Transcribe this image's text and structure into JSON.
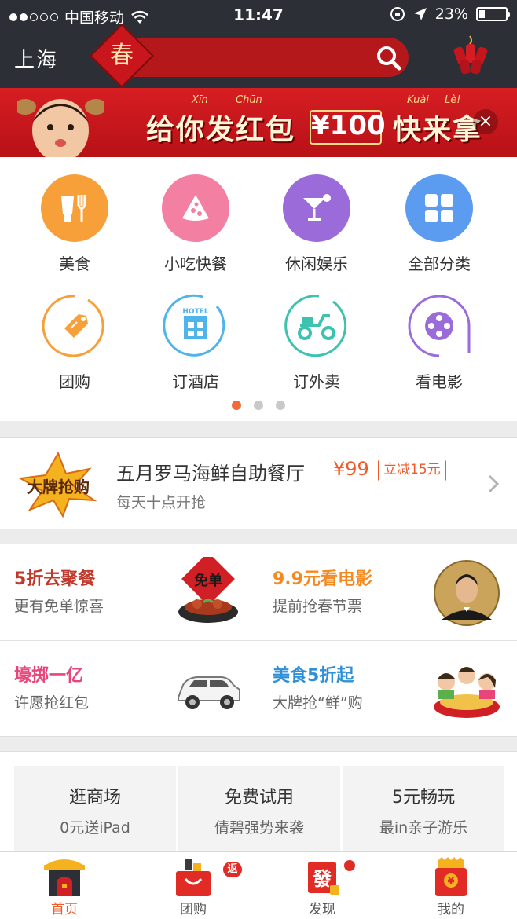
{
  "status_bar": {
    "carrier": "中国移动",
    "time": "11:47",
    "battery_percent": "23%",
    "battery_level": 0.23,
    "signal_filled": 2,
    "signal_total": 5
  },
  "header": {
    "city": "上海",
    "search_badge": "春",
    "search_icon": "search-icon",
    "right_icon": "firecracker-icon"
  },
  "banner": {
    "pinyin": [
      "Xīn",
      "Chūn",
      "Kuài",
      "Lè!"
    ],
    "text_left": "给你发红包",
    "money": "¥100",
    "text_right": "快来拿",
    "close": "×"
  },
  "categories": [
    {
      "label": "美食",
      "icon": "food-icon",
      "color": "#f7a03a"
    },
    {
      "label": "小吃快餐",
      "icon": "pizza-slice-icon",
      "color": "#f37fa3"
    },
    {
      "label": "休闲娱乐",
      "icon": "cocktail-icon",
      "color": "#9b6bd9"
    },
    {
      "label": "全部分类",
      "icon": "grid-icon",
      "color": "#5b9bf0"
    },
    {
      "label": "团购",
      "icon": "tag-icon",
      "color": "#f7a03a"
    },
    {
      "label": "订酒店",
      "icon": "hotel-icon",
      "color": "#4fb4ea",
      "icon_text": "HOTEL"
    },
    {
      "label": "订外卖",
      "icon": "scooter-icon",
      "color": "#3cc3b0"
    },
    {
      "label": "看电影",
      "icon": "film-reel-icon",
      "color": "#9b6bd9"
    }
  ],
  "pager": {
    "count": 3,
    "active": 0
  },
  "promo": {
    "badge": "大牌抢购",
    "title": "五月罗马海鲜自助餐厅",
    "price": "¥99",
    "tag": "立减15元",
    "subtitle": "每天十点开抢"
  },
  "deals": [
    {
      "title": "5折去聚餐",
      "subtitle": "更有免单惊喜",
      "color": "#c0392b",
      "image_label": "免单"
    },
    {
      "title": "9.9元看电影",
      "subtitle": "提前抢春节票",
      "color": "#f5891f",
      "image": "actor-portrait"
    },
    {
      "title": "壕掷一亿",
      "subtitle": "许愿抢红包",
      "color": "#e8457a",
      "image": "white-suv"
    },
    {
      "title": "美食5折起",
      "subtitle": "大牌抢“鲜”购",
      "color": "#2f8fd8",
      "image": "family-dinner"
    }
  ],
  "cards": [
    {
      "title": "逛商场",
      "subtitle": "0元送iPad"
    },
    {
      "title": "免费试用",
      "subtitle": "倩碧强势来袭"
    },
    {
      "title": "5元畅玩",
      "subtitle": "最in亲子游乐"
    }
  ],
  "tabs": [
    {
      "label": "首页",
      "icon": "home-gate-icon",
      "active": true
    },
    {
      "label": "团购",
      "icon": "shopping-bag-icon",
      "badge": "返"
    },
    {
      "label": "发现",
      "icon": "fa-tile-icon",
      "badge_dot": true,
      "icon_text": "發"
    },
    {
      "label": "我的",
      "icon": "red-envelope-icon",
      "icon_text": "¥"
    }
  ]
}
